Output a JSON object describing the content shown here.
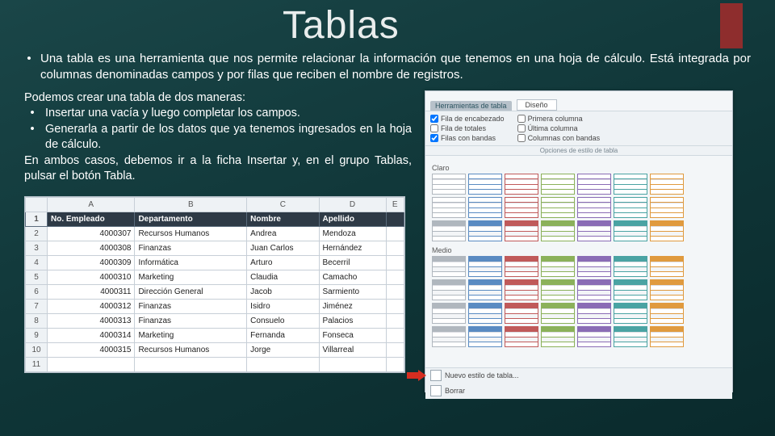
{
  "title": "Tablas",
  "lead_bullet1": "Una tabla es una herramienta que nos permite relacionar la información que tenemos en una hoja de cálculo. Está integrada por columnas denominadas campos y por filas que reciben el nombre de registros.",
  "left": {
    "intro": "Podemos crear una tabla de dos maneras:",
    "b1": "Insertar una vacía y luego completar los campos.",
    "b2": "Generarla a partir de los datos que ya tenemos ingresados en la hoja de cálculo.",
    "outro": "En ambos casos, debemos ir a la ficha Insertar y, en el grupo Tablas, pulsar el botón Tabla."
  },
  "table": {
    "cols": [
      "",
      "A",
      "B",
      "C",
      "D",
      "E"
    ],
    "header": [
      "No. Empleado",
      "Departamento",
      "Nombre",
      "Apellido"
    ],
    "rows": [
      [
        "4000307",
        "Recursos Humanos",
        "Andrea",
        "Mendoza"
      ],
      [
        "4000308",
        "Finanzas",
        "Juan Carlos",
        "Hernández"
      ],
      [
        "4000309",
        "Informática",
        "Arturo",
        "Becerril"
      ],
      [
        "4000310",
        "Marketing",
        "Claudia",
        "Camacho"
      ],
      [
        "4000311",
        "Dirección General",
        "Jacob",
        "Sarmiento"
      ],
      [
        "4000312",
        "Finanzas",
        "Isidro",
        "Jiménez"
      ],
      [
        "4000313",
        "Finanzas",
        "Consuelo",
        "Palacios"
      ],
      [
        "4000314",
        "Marketing",
        "Fernanda",
        "Fonseca"
      ],
      [
        "4000315",
        "Recursos Humanos",
        "Jorge",
        "Villarreal"
      ]
    ]
  },
  "ribbon": {
    "context_tab": "Herramientas de tabla",
    "design_tab": "Diseño",
    "ck1": "Fila de encabezado",
    "ck2": "Fila de totales",
    "ck3": "Filas con bandas",
    "ck4": "Primera columna",
    "ck5": "Última columna",
    "ck6": "Columnas con bandas",
    "sec_label": "Opciones de estilo de tabla",
    "gallery_sec1": "Claro",
    "gallery_sec2": "Medio",
    "opt_new": "Nuevo estilo de tabla...",
    "opt_clear": "Borrar"
  },
  "swatch_colors": [
    "#b0b7be",
    "#5a8bc2",
    "#c05a5a",
    "#8bb15a",
    "#8a6cb5",
    "#4aa3a3",
    "#e09a3e"
  ]
}
